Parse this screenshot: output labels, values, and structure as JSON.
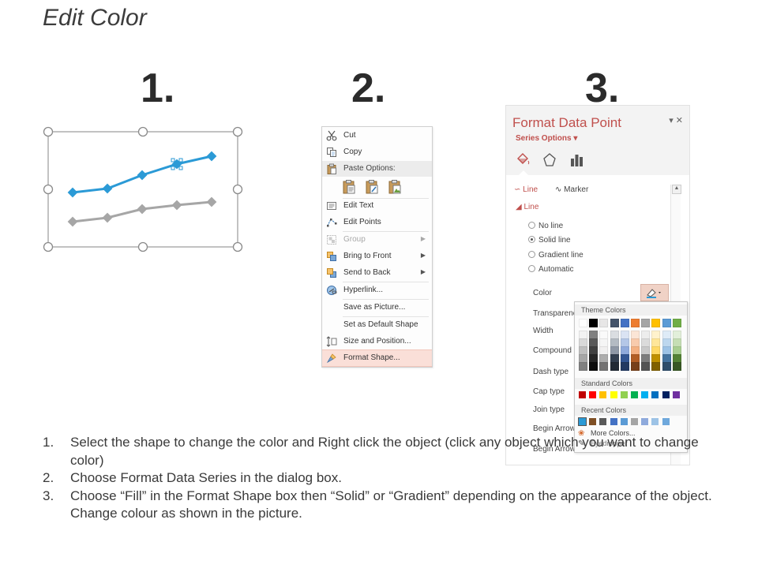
{
  "title": "Edit Color",
  "step_numbers": [
    "1.",
    "2.",
    "3."
  ],
  "colors": {
    "series_primary": "#2b9ad6",
    "series_secondary": "#a6a6a6",
    "pane_title": "#c0504d",
    "menu_highlight": "#fadfd8"
  },
  "context_menu": {
    "items": [
      {
        "label": "Cut",
        "icon": "scissors-icon"
      },
      {
        "label": "Copy",
        "icon": "copy-icon"
      },
      {
        "label": "Paste Options:",
        "icon": "clipboard-icon"
      },
      {
        "label": "Edit Text",
        "icon": "edit-text-icon"
      },
      {
        "label": "Edit Points",
        "icon": "edit-points-icon"
      },
      {
        "label": "Group",
        "icon": "group-icon",
        "disabled": true,
        "submenu": true
      },
      {
        "label": "Bring to Front",
        "icon": "bring-to-front-icon",
        "submenu": true
      },
      {
        "label": "Send to Back",
        "icon": "send-to-back-icon",
        "submenu": true
      },
      {
        "label": "Hyperlink...",
        "icon": "hyperlink-icon"
      },
      {
        "label": "Save as Picture...",
        "icon": ""
      },
      {
        "label": "Set as Default Shape",
        "icon": ""
      },
      {
        "label": "Size and Position...",
        "icon": "size-position-icon"
      },
      {
        "label": "Format Shape...",
        "icon": "format-shape-icon",
        "highlighted": true
      }
    ]
  },
  "format_pane": {
    "title": "Format Data Point",
    "series_options": "Series Options",
    "tab_line": "Line",
    "tab_marker": "Marker",
    "section_line": "Line",
    "options": [
      {
        "label": "No line",
        "selected": false
      },
      {
        "label": "Solid line",
        "selected": true
      },
      {
        "label": "Gradient line",
        "selected": false
      },
      {
        "label": "Automatic",
        "selected": false
      }
    ],
    "props": [
      "Color",
      "Transparenc",
      "Width",
      "Compound",
      "Dash type",
      "Cap type",
      "Join type",
      "Begin Arrow",
      "Begin Arrow"
    ]
  },
  "color_dropdown": {
    "theme_header": "Theme Colors",
    "standard_header": "Standard Colors",
    "recent_header": "Recent Colors",
    "more_colors": "More Colors...",
    "eyedropper": "Eyedropper",
    "theme_top": [
      "#ffffff",
      "#000000",
      "#e7e6e6",
      "#44546a",
      "#4472c4",
      "#ed7d31",
      "#a5a5a5",
      "#ffc000",
      "#5b9bd5",
      "#70ad47"
    ],
    "standard": [
      "#c00000",
      "#ff0000",
      "#ffc000",
      "#ffff00",
      "#92d050",
      "#00b050",
      "#00b0f0",
      "#0070c0",
      "#002060",
      "#7030a0"
    ],
    "recent": [
      "#2b9ad6",
      "#7f4f24",
      "#595959",
      "#4472c4",
      "#5b9bd5",
      "#a5a5a5",
      "#8faadc",
      "#9dc3e6",
      "#6fa8dc"
    ]
  },
  "instructions": [
    {
      "num": "1.",
      "text": "Select the shape to change the color and Right click the object (click any object which you want to change color)"
    },
    {
      "num": "2.",
      "text": "Choose Format Data Series in the dialog box."
    },
    {
      "num": "3.",
      "text": "Choose “Fill” in the Format Shape box then “Solid” or “Gradient” depending on the appearance of the object. Change colour as shown in the picture."
    }
  ]
}
